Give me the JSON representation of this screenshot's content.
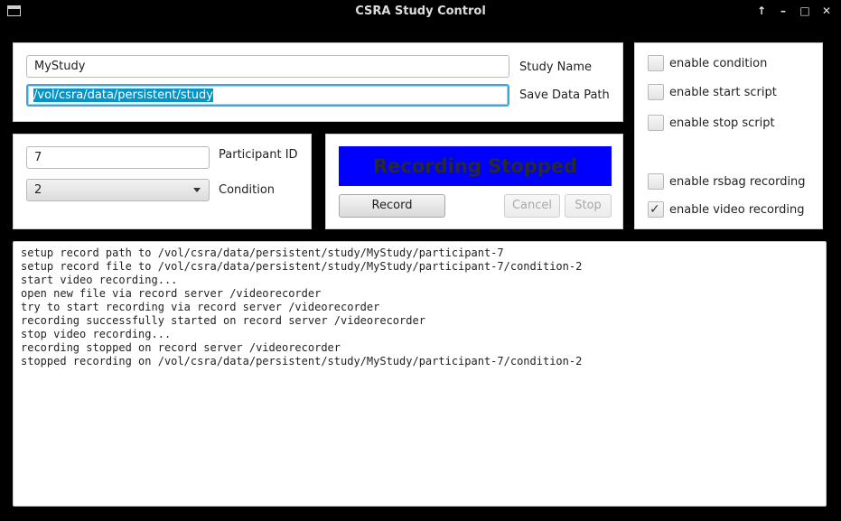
{
  "window": {
    "title": "CSRA Study Control",
    "buttons": {
      "up": "↑",
      "minimize": "–",
      "maximize": "□",
      "close": "✕"
    }
  },
  "study": {
    "name_value": "MyStudy",
    "name_label": "Study Name",
    "path_value": "/vol/csra/data/persistent/study",
    "path_label": "Save Data Path"
  },
  "participant": {
    "id_value": "7",
    "id_label": "Participant ID",
    "condition_value": "2",
    "condition_label": "Condition"
  },
  "recording": {
    "status": "Recording Stopped",
    "record_label": "Record",
    "cancel_label": "Cancel",
    "stop_label": "Stop",
    "status_bg": "#0000ff"
  },
  "options": [
    {
      "label": "enable condition",
      "checked": false
    },
    {
      "label": "enable start script",
      "checked": false
    },
    {
      "label": "enable stop script",
      "checked": false
    },
    {
      "label": "enable rsbag recording",
      "checked": false
    },
    {
      "label": "enable video recording",
      "checked": true
    }
  ],
  "log": [
    "setup record path to /vol/csra/data/persistent/study/MyStudy/participant-7",
    "setup record file to /vol/csra/data/persistent/study/MyStudy/participant-7/condition-2",
    "start video recording...",
    "open new file via record server /videorecorder",
    "try to start recording via record server /videorecorder",
    "recording successfully started on record server /videorecorder",
    "stop video recording...",
    "recording stopped on record server /videorecorder",
    "stopped recording on /vol/csra/data/persistent/study/MyStudy/participant-7/condition-2"
  ]
}
